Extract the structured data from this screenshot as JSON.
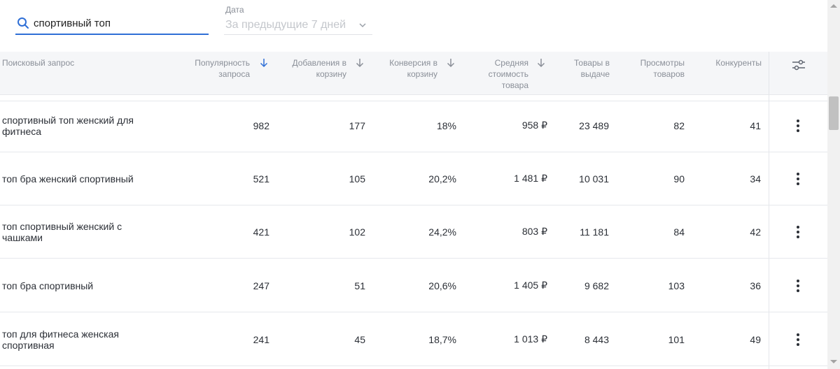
{
  "search": {
    "value": "спортивный топ",
    "icon": "search-icon"
  },
  "date_filter": {
    "label": "Дата",
    "value": "За предыдущие 7 дней"
  },
  "table": {
    "columns": [
      {
        "key": "query",
        "label": "Поисковый запрос",
        "sortable": false
      },
      {
        "key": "popularity",
        "label": "Популярность запроса",
        "sortable": true,
        "active": true
      },
      {
        "key": "cart_adds",
        "label": "Добавления в корзину",
        "sortable": true
      },
      {
        "key": "cart_conversion",
        "label": "Конверсия в корзину",
        "sortable": true
      },
      {
        "key": "avg_price",
        "label": "Средняя стоимость товара",
        "sortable": true
      },
      {
        "key": "products",
        "label": "Товары в выдаче",
        "sortable": false
      },
      {
        "key": "views",
        "label": "Просмотры товаров",
        "sortable": false
      },
      {
        "key": "competitors",
        "label": "Конкуренты",
        "sortable": false
      }
    ],
    "rows": [
      {
        "query": "спортивный топ женский для фитнеса",
        "popularity": "982",
        "cart_adds": "177",
        "cart_conversion": "18%",
        "avg_price": "958 ₽",
        "products": "23 489",
        "views": "82",
        "competitors": "41"
      },
      {
        "query": "топ бра женский спортивный",
        "popularity": "521",
        "cart_adds": "105",
        "cart_conversion": "20,2%",
        "avg_price": "1 481 ₽",
        "products": "10 031",
        "views": "90",
        "competitors": "34"
      },
      {
        "query": "топ спортивный женский с чашками",
        "popularity": "421",
        "cart_adds": "102",
        "cart_conversion": "24,2%",
        "avg_price": "803 ₽",
        "products": "11 181",
        "views": "84",
        "competitors": "42"
      },
      {
        "query": "топ бра спортивный",
        "popularity": "247",
        "cart_adds": "51",
        "cart_conversion": "20,6%",
        "avg_price": "1 405 ₽",
        "products": "9 682",
        "views": "103",
        "competitors": "36"
      },
      {
        "query": "топ для фитнеса женская спортивная",
        "popularity": "241",
        "cart_adds": "45",
        "cart_conversion": "18,7%",
        "avg_price": "1 013 ₽",
        "products": "8 443",
        "views": "101",
        "competitors": "49"
      }
    ]
  },
  "colors": {
    "accent": "#2f6fd6",
    "header_bg": "#f5f6f8",
    "muted_text": "#8a8f98"
  }
}
